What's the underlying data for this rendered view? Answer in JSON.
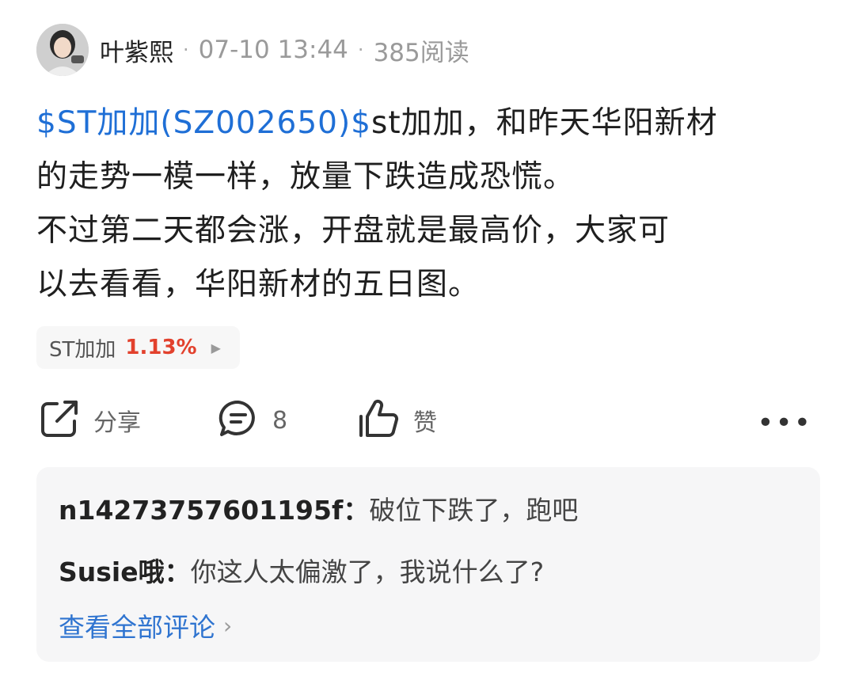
{
  "post": {
    "author": "叶紫熙",
    "time": "07-10 13:44",
    "reads": "385阅读",
    "stock_link": "$ST加加(SZ002650)$",
    "text_line1": "st加加，和昨天华阳新材",
    "text_line2": "的走势一模一样，放量下跌造成恐慌。",
    "text_line3": "不过第二天都会涨，开盘就是最高价，大家可",
    "text_line4": "以去看看，华阳新材的五日图。"
  },
  "stock_tag": {
    "name": "ST加加",
    "change": "1.13%",
    "change_color": "#e2412d"
  },
  "actions": {
    "share_label": "分享",
    "comment_count": "8",
    "like_label": "赞"
  },
  "comments": [
    {
      "user": "n14273757601195f",
      "sep": "：",
      "text": "破位下跌了，跑吧"
    },
    {
      "user": "Susie哦",
      "sep": "：",
      "text": "你这人太偏激了，我说什么了?"
    }
  ],
  "view_all": "查看全部评论",
  "colors": {
    "link": "#1f6fd6",
    "view_all": "#2f74d0"
  },
  "icons": [
    "share-icon",
    "comment-icon",
    "like-icon",
    "more-icon",
    "chevron-right-icon"
  ]
}
